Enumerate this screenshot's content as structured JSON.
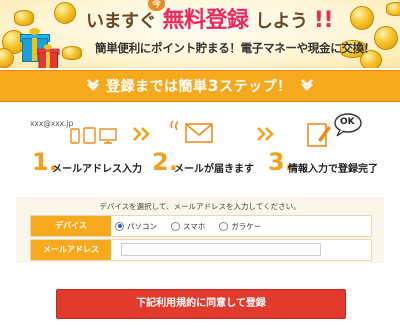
{
  "hero": {
    "headline_part1": "いますぐ",
    "headline_part2": "無料登録",
    "headline_part3": "しよう",
    "headline_part4": "!!",
    "badge": "今",
    "subline": "簡単便利にポイント貯まる！電子マネーや現金に交換！"
  },
  "stepbar": {
    "title_pre": "登録までは簡単",
    "title_num": "3",
    "title_post": "ステップ！"
  },
  "steps": [
    {
      "num": "1.",
      "label": "メールアドレス入力",
      "icon": "devices-icon"
    },
    {
      "num": "2.",
      "label": "メールが届きます",
      "icon": "envelope-icon"
    },
    {
      "num": "3.",
      "label": "情報入力で登録完了",
      "icon": "ok-document-icon"
    }
  ],
  "step1_email_sample": "xxx@xxx.jp",
  "step3_ok_text": "OK",
  "form": {
    "instruction": "デバイスを選択して、メールアドレスを入力してください。",
    "device_label": "デバイス",
    "device_options": [
      "パソコン",
      "スマホ",
      "ガラケー"
    ],
    "device_selected": "パソコン",
    "email_label": "メールアドレス",
    "email_value": "",
    "email_placeholder": ""
  },
  "submit_label": "下記利用規約に同意して登録",
  "colors": {
    "accent_orange": "#f6a91c",
    "headline_pink": "#ef2a5a",
    "submit_red": "#e23b2e",
    "form_bg": "#fbf6ea"
  }
}
